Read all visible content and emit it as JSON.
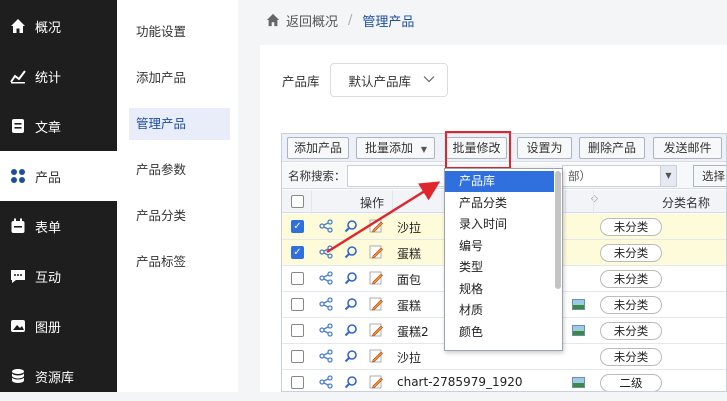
{
  "sidebar": {
    "items": [
      {
        "label": "概况",
        "icon": "home-icon"
      },
      {
        "label": "统计",
        "icon": "chart-icon"
      },
      {
        "label": "文章",
        "icon": "article-icon"
      },
      {
        "label": "产品",
        "icon": "grid-icon",
        "active": true
      },
      {
        "label": "表单",
        "icon": "calendar-icon"
      },
      {
        "label": "互动",
        "icon": "chat-icon"
      },
      {
        "label": "图册",
        "icon": "image-icon"
      },
      {
        "label": "资源库",
        "icon": "database-icon"
      }
    ]
  },
  "subnav": {
    "items": [
      {
        "label": "功能设置"
      },
      {
        "label": "添加产品"
      },
      {
        "label": "管理产品",
        "active": true
      },
      {
        "label": "产品参数"
      },
      {
        "label": "产品分类"
      },
      {
        "label": "产品标签"
      }
    ]
  },
  "breadcrumb": {
    "back": "返回概况",
    "sep": "/",
    "current": "管理产品"
  },
  "library": {
    "label": "产品库",
    "value": "默认产品库"
  },
  "toolbar": {
    "add": "添加产品",
    "batch_add": "批量添加",
    "batch_edit": "批量修改",
    "set_as": "设置为",
    "delete": "删除产品",
    "send_mail": "发送邮件"
  },
  "search": {
    "label": "名称搜索：",
    "select_value": "部）",
    "button": "选择"
  },
  "table": {
    "header_op": "操作",
    "header_cat": "分类名称",
    "rows": [
      {
        "name": "沙拉",
        "category": "未分类",
        "checked": true,
        "thumb": false
      },
      {
        "name": "蛋糕",
        "category": "未分类",
        "checked": true,
        "thumb": false
      },
      {
        "name": "面包",
        "category": "未分类",
        "checked": false,
        "thumb": false
      },
      {
        "name": "蛋糕",
        "category": "未分类",
        "checked": false,
        "thumb": true
      },
      {
        "name": "蛋糕2",
        "category": "未分类",
        "checked": false,
        "thumb": true
      },
      {
        "name": "沙拉",
        "category": "未分类",
        "checked": false,
        "thumb": false
      },
      {
        "name": "chart-2785979_1920",
        "category": "二级",
        "checked": false,
        "thumb": true
      }
    ]
  },
  "dropdown": {
    "items": [
      "产品库",
      "产品分类",
      "录入时间",
      "编号",
      "类型",
      "规格",
      "材质",
      "颜色"
    ],
    "highlighted": 0
  },
  "colors": {
    "accent": "#1d4ea1",
    "highlight": "#2f6fde",
    "annotation": "#e0262d"
  }
}
